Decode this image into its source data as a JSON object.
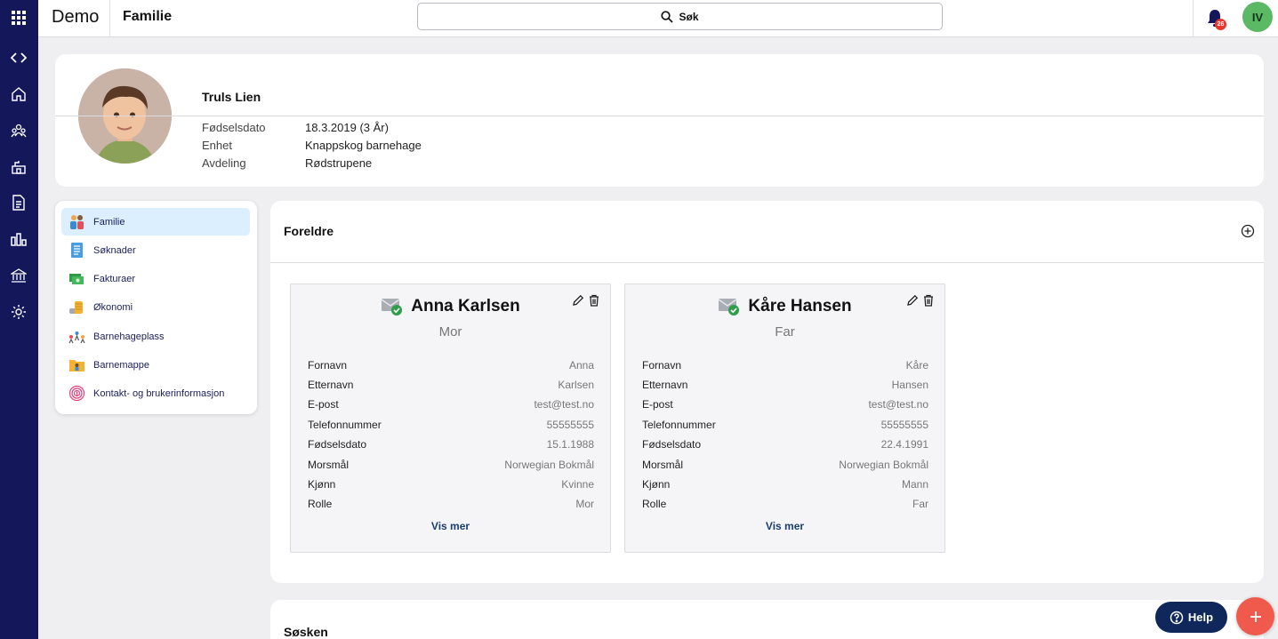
{
  "topbar": {
    "app_name": "Demo",
    "page_name": "Familie",
    "search_label": "Søk",
    "notification_count": "26",
    "user_initials": "IV"
  },
  "rail": {
    "icons": [
      "apps-grid-icon",
      "code-toggle-icon",
      "home-icon",
      "groups-icon",
      "building-icon",
      "document-icon",
      "bar-chart-icon",
      "bank-icon",
      "gear-icon"
    ]
  },
  "profile": {
    "name": "Truls Lien",
    "rows": [
      {
        "label": "Fødselsdato",
        "value": "18.3.2019 (3 År)"
      },
      {
        "label": "Enhet",
        "value": "Knappskog barnehage"
      },
      {
        "label": "Avdeling",
        "value": "Rødstrupene"
      }
    ]
  },
  "menu": {
    "items": [
      {
        "label": "Familie",
        "icon": "family-icon",
        "active": true
      },
      {
        "label": "Søknader",
        "icon": "application-form-icon",
        "active": false
      },
      {
        "label": "Fakturaer",
        "icon": "invoice-icon",
        "active": false
      },
      {
        "label": "Økonomi",
        "icon": "coins-icon",
        "active": false
      },
      {
        "label": "Barnehageplass",
        "icon": "kindergarten-icon",
        "active": false
      },
      {
        "label": "Barnemappe",
        "icon": "child-folder-icon",
        "active": false
      },
      {
        "label": "Kontakt- og brukerinformasjon",
        "icon": "fingerprint-icon",
        "active": false
      }
    ]
  },
  "parents": {
    "title": "Foreldre",
    "more_label": "Vis mer",
    "cards": [
      {
        "name": "Anna Karlsen",
        "role": "Mor",
        "fields": [
          {
            "k": "Fornavn",
            "v": "Anna"
          },
          {
            "k": "Etternavn",
            "v": "Karlsen"
          },
          {
            "k": "E-post",
            "v": "test@test.no"
          },
          {
            "k": "Telefonnummer",
            "v": "55555555"
          },
          {
            "k": "Fødselsdato",
            "v": "15.1.1988"
          },
          {
            "k": "Morsmål",
            "v": "Norwegian Bokmål"
          },
          {
            "k": "Kjønn",
            "v": "Kvinne"
          },
          {
            "k": "Rolle",
            "v": "Mor"
          }
        ]
      },
      {
        "name": "Kåre Hansen",
        "role": "Far",
        "fields": [
          {
            "k": "Fornavn",
            "v": "Kåre"
          },
          {
            "k": "Etternavn",
            "v": "Hansen"
          },
          {
            "k": "E-post",
            "v": "test@test.no"
          },
          {
            "k": "Telefonnummer",
            "v": "55555555"
          },
          {
            "k": "Fødselsdato",
            "v": "22.4.1991"
          },
          {
            "k": "Morsmål",
            "v": "Norwegian Bokmål"
          },
          {
            "k": "Kjønn",
            "v": "Mann"
          },
          {
            "k": "Rolle",
            "v": "Far"
          }
        ]
      }
    ]
  },
  "siblings": {
    "title": "Søsken"
  },
  "help_label": "Help",
  "colors": {
    "rail": "#14175a",
    "active_menu": "#dcefff",
    "fab": "#ef5a4c",
    "help": "#10275c",
    "avatar": "#5bb865"
  }
}
